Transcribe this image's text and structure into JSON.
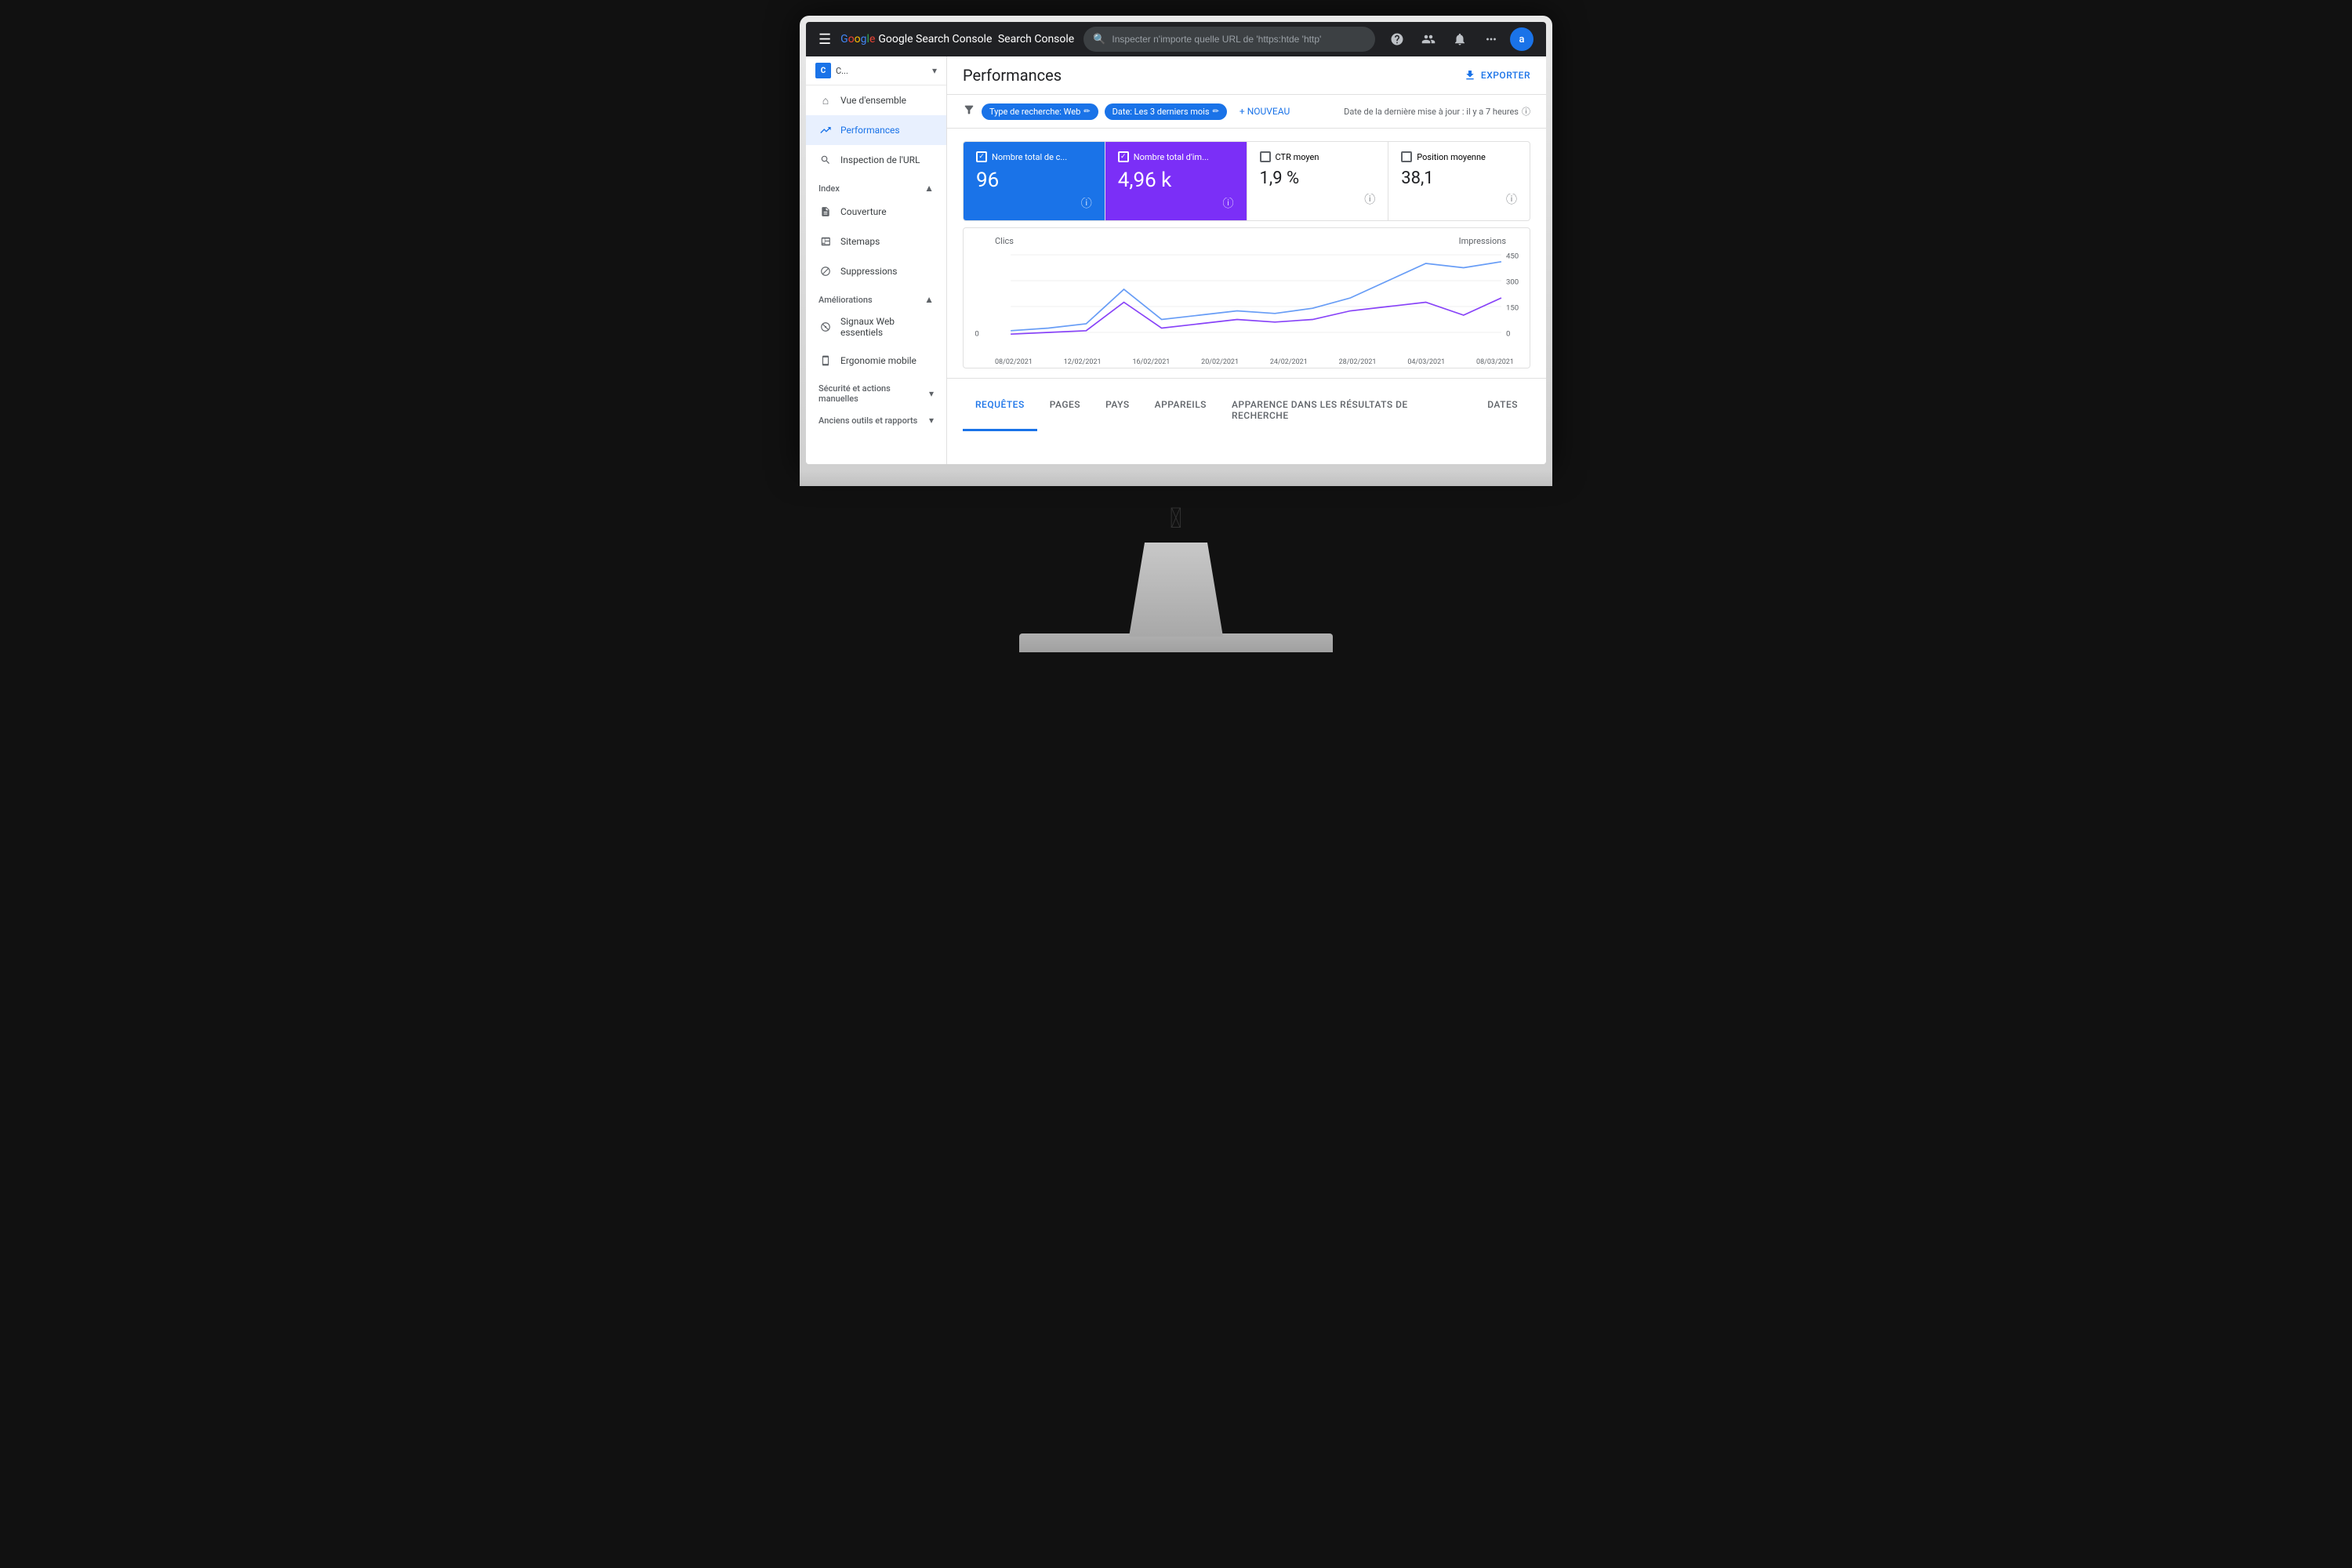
{
  "topbar": {
    "hamburger_icon": "☰",
    "logo_text": "Google Search Console",
    "search_placeholder": "Inspecter n'importe quelle URL de 'https:htde 'http'",
    "help_icon": "?",
    "users_icon": "👤",
    "bell_icon": "🔔",
    "apps_icon": "⠿",
    "avatar": "a"
  },
  "sidebar": {
    "property_icon": "C",
    "property_name": "C...",
    "nav_items": [
      {
        "label": "Vue d'ensemble",
        "icon": "⌂",
        "active": false
      },
      {
        "label": "Performances",
        "icon": "↗",
        "active": true
      },
      {
        "label": "Inspection de l'URL",
        "icon": "🔍",
        "active": false
      }
    ],
    "index_section": "Index",
    "index_items": [
      {
        "label": "Couverture",
        "icon": "📄"
      },
      {
        "label": "Sitemaps",
        "icon": "⊞"
      },
      {
        "label": "Suppressions",
        "icon": "🚫"
      }
    ],
    "ameliorations_section": "Améliorations",
    "ameliorations_items": [
      {
        "label": "Signaux Web essentiels",
        "icon": "⊙"
      },
      {
        "label": "Ergonomie mobile",
        "icon": "📱"
      }
    ],
    "security_section": "Sécurité et actions manuelles",
    "old_tools_section": "Anciens outils et rapports"
  },
  "content": {
    "title": "Performances",
    "export_label": "EXPORTER",
    "filters": {
      "filter_icon": "⚙",
      "chips": [
        {
          "label": "Type de recherche: Web",
          "editable": true
        },
        {
          "label": "Date: Les 3 derniers mois",
          "editable": true
        }
      ],
      "new_label": "+ NOUVEAU",
      "last_update": "Date de la dernière mise à jour : il y a 7 heures"
    },
    "stats": [
      {
        "id": "clicks",
        "label": "Nombre total de c...",
        "value": "96",
        "checked": true,
        "style": "active-blue"
      },
      {
        "id": "impressions",
        "label": "Nombre total d'im...",
        "value": "4,96 k",
        "checked": true,
        "style": "active-purple"
      },
      {
        "id": "ctr",
        "label": "CTR moyen",
        "value": "1,9 %",
        "checked": false,
        "style": ""
      },
      {
        "id": "position",
        "label": "Position moyenne",
        "value": "38,1",
        "checked": false,
        "style": ""
      }
    ],
    "chart": {
      "left_axis_label": "Clics",
      "right_axis_label": "Impressions",
      "y_right_values": [
        "450",
        "300",
        "150",
        "0"
      ],
      "x_labels": [
        "08/02/2021",
        "12/02/2021",
        "16/02/2021",
        "20/02/2021",
        "24/02/2021",
        "28/02/2021",
        "04/03/2021",
        "08/03/2021"
      ]
    },
    "tabs": [
      {
        "label": "REQUÊTES",
        "active": true
      },
      {
        "label": "PAGES",
        "active": false
      },
      {
        "label": "PAYS",
        "active": false
      },
      {
        "label": "APPAREILS",
        "active": false
      },
      {
        "label": "APPARENCE DANS LES RÉSULTATS DE RECHERCHE",
        "active": false
      },
      {
        "label": "DATES",
        "active": false
      }
    ]
  }
}
